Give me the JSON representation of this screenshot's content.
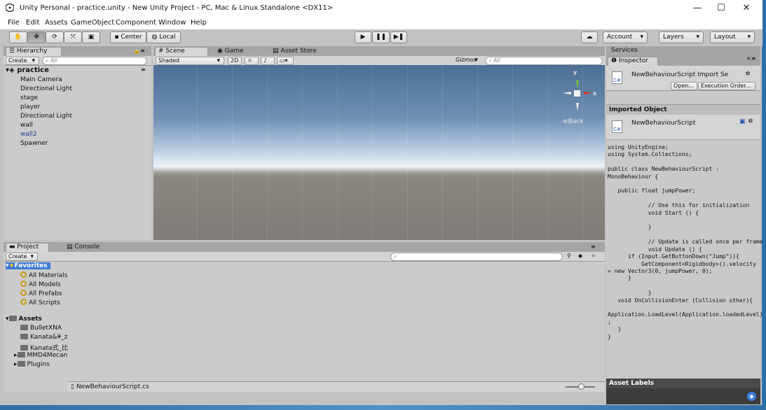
{
  "window": {
    "title": "Unity Personal - practice.unity - New Unity Project - PC, Mac & Linux Standalone <DX11>",
    "minimize": "—",
    "maximize": "☐",
    "close": "✕"
  },
  "menu": [
    "File",
    "Edit",
    "Assets",
    "GameObject",
    "Component",
    "Window",
    "Help"
  ],
  "toolbar": {
    "center": "Center",
    "local": "Local",
    "account": "Account",
    "layers": "Layers",
    "layout": "Layout"
  },
  "hierarchy": {
    "tab": "Hierarchy",
    "create": "Create",
    "search": "All",
    "scene": "practice",
    "items": [
      "Main Camera",
      "Directional Light",
      "stage",
      "player",
      "Directional Light",
      "wall",
      "wall2",
      "Spawner"
    ]
  },
  "scene": {
    "tabs": [
      "Scene",
      "Game",
      "Asset Store"
    ],
    "shading": "Shaded",
    "mode2d": "2D",
    "gizmos": "Gizmos",
    "search": "All",
    "gizmo_y": "y",
    "gizmo_x": "x",
    "back": "Back"
  },
  "project": {
    "tabs": [
      "Project",
      "Console"
    ],
    "create": "Create",
    "favorites": "Favorites",
    "favorite_items": [
      "All Materials",
      "All Models",
      "All Prefabs",
      "All Scripts"
    ],
    "assets": "Assets",
    "asset_items": [
      "BulletXNA",
      "Kanata&¥_z",
      "Kanata式_比",
      "MMD4Mecan",
      "Plugins"
    ],
    "footer_file": "NewBehaviourScript.cs"
  },
  "inspector": {
    "tabs": [
      "Services",
      "Inspector"
    ],
    "header_title": "NewBehaviourScript Import Se",
    "open_btn": "Open...",
    "exec_btn": "Execution Order...",
    "imported_object": "Imported Object",
    "script_name": "NewBehaviourScript",
    "code": [
      "using UnityEngine;",
      "using System.Collections;",
      "",
      "public class NewBehaviourScript :",
      "MonoBehaviour {",
      "",
      "   public float jumpPower;",
      "",
      "            // Use this for initialization",
      "            void Start () {",
      "",
      "            }",
      "",
      "            // Update is called once per frame",
      "            void Update () {",
      "      if (Input.GetButtonDown(\"Jump\")){",
      "          GetComponent<Rigidbody>().velocity",
      "= new Vector3(0, jumpPower, 0);",
      "      }",
      "",
      "            }",
      "   void OnCollisionEnter (Collision other){",
      "",
      "Application.LoadLevel(Application.loadedLevel)",
      ";",
      "   }",
      "}"
    ],
    "asset_labels": "Asset Labels",
    "cs_label": "C#"
  },
  "colors": {
    "panel": "#cbcbcb",
    "selection": "#3d7ad6",
    "sky_top": "#4d6f95",
    "ground": "#7f7b76"
  }
}
